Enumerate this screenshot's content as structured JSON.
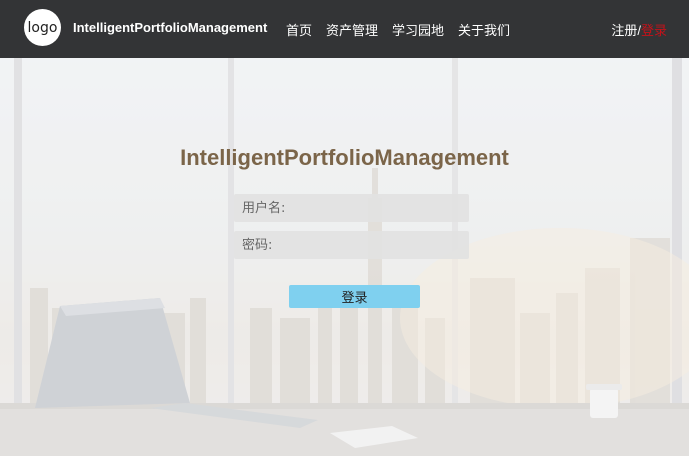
{
  "navbar": {
    "logo_text": "logo",
    "brand": "IntelligentPortfolioManagement",
    "links": [
      "首页",
      "资产管理",
      "学习园地",
      "关于我们"
    ],
    "register": "注册",
    "separator": "/",
    "login": "登录"
  },
  "login_form": {
    "title": "IntelligentPortfolioManagement",
    "username_placeholder": "用户名:",
    "password_placeholder": "密码:",
    "submit_label": "登录"
  },
  "colors": {
    "navbar_bg": "#333436",
    "title": "#7b6549",
    "login_link": "#c4121a",
    "button": "#7fd0ef"
  }
}
